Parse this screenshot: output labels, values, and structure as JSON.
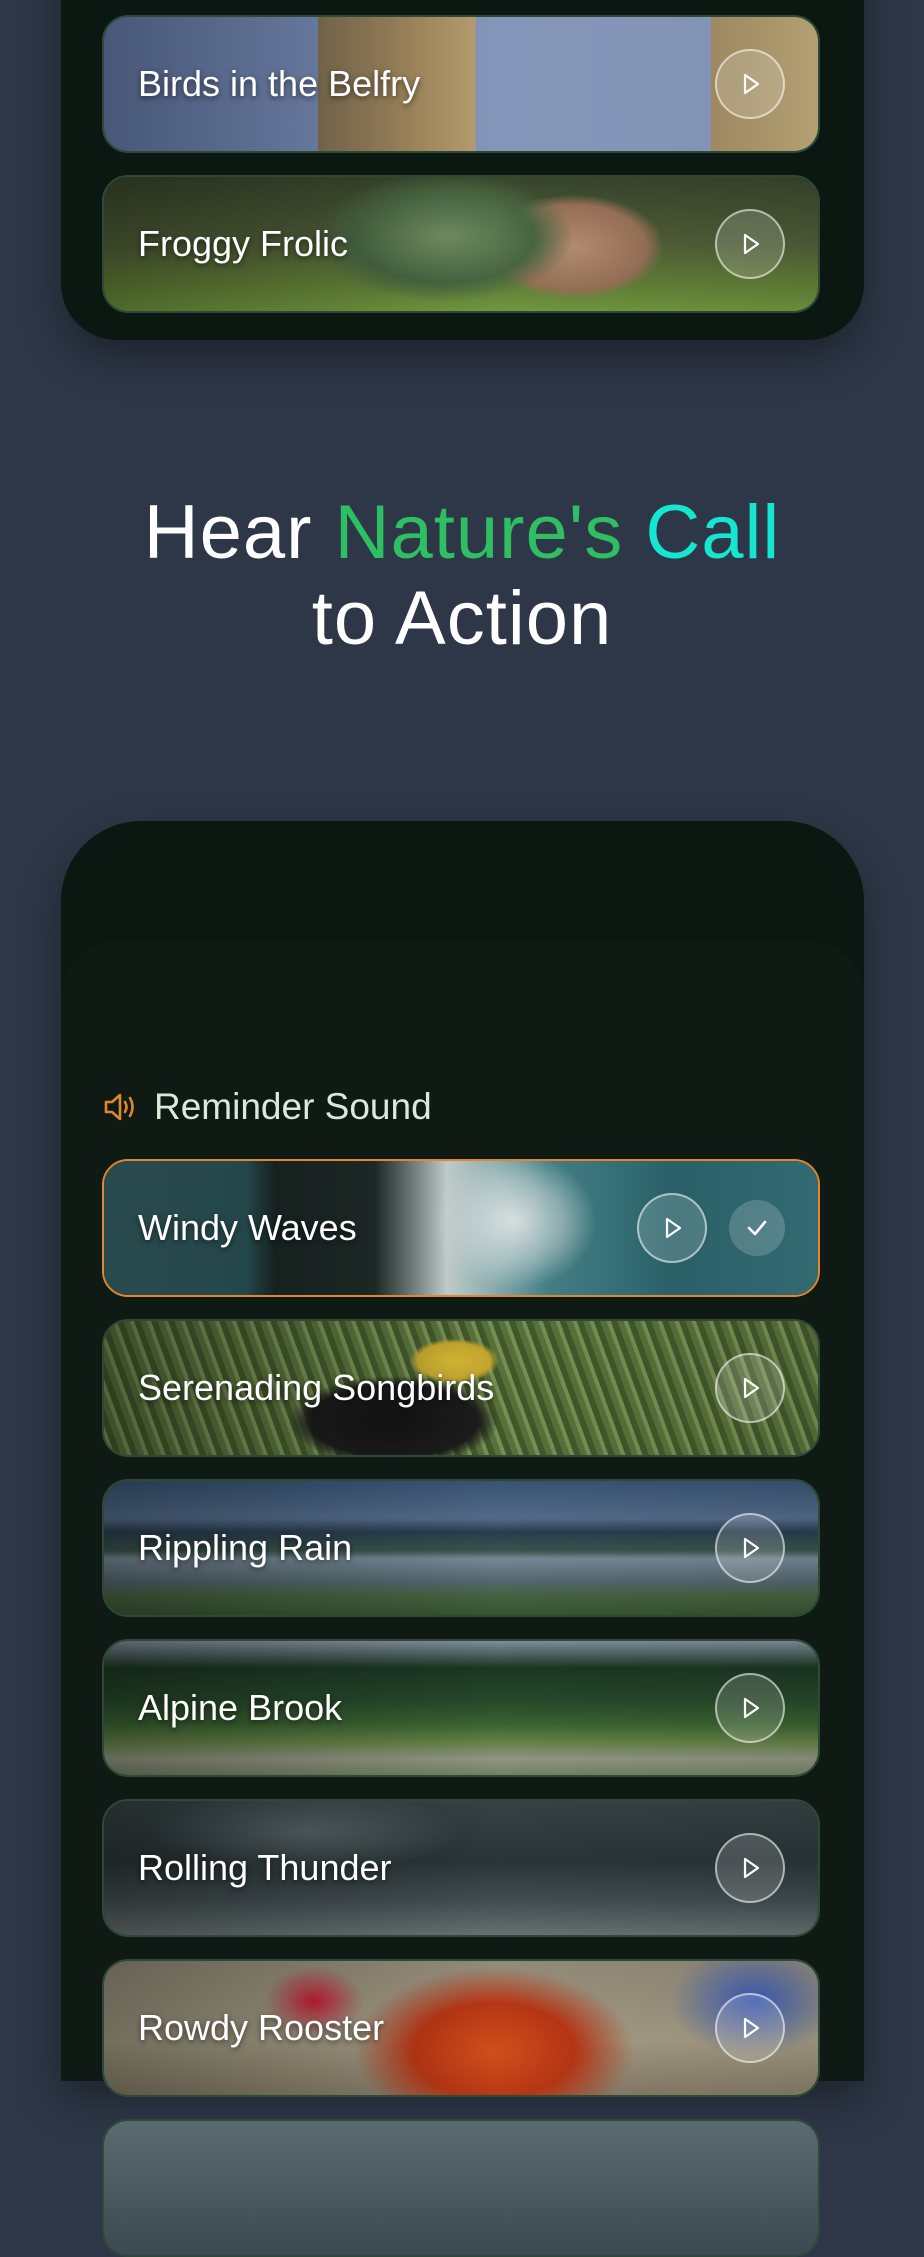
{
  "headline": {
    "part1": "Hear",
    "part2": "Nature's",
    "part3": "Call",
    "line2": "to Action"
  },
  "top_list": [
    {
      "label": "Birds in the Belfry"
    },
    {
      "label": "Froggy Frolic"
    }
  ],
  "reminder": {
    "title": "Reminder Sound",
    "selected_index": 0,
    "items": [
      {
        "label": "Windy Waves"
      },
      {
        "label": "Serenading Songbirds"
      },
      {
        "label": "Rippling Rain"
      },
      {
        "label": "Alpine Brook"
      },
      {
        "label": "Rolling Thunder"
      },
      {
        "label": "Rowdy Rooster"
      }
    ]
  },
  "icons": {
    "play": "play-icon",
    "check": "check-icon",
    "speaker": "speaker-icon"
  },
  "colors": {
    "background": "#2e3747",
    "panel": "#0b1711",
    "accent_green": "#2fbf63",
    "accent_cyan": "#14e6cf",
    "selected_border": "#e0872f"
  }
}
